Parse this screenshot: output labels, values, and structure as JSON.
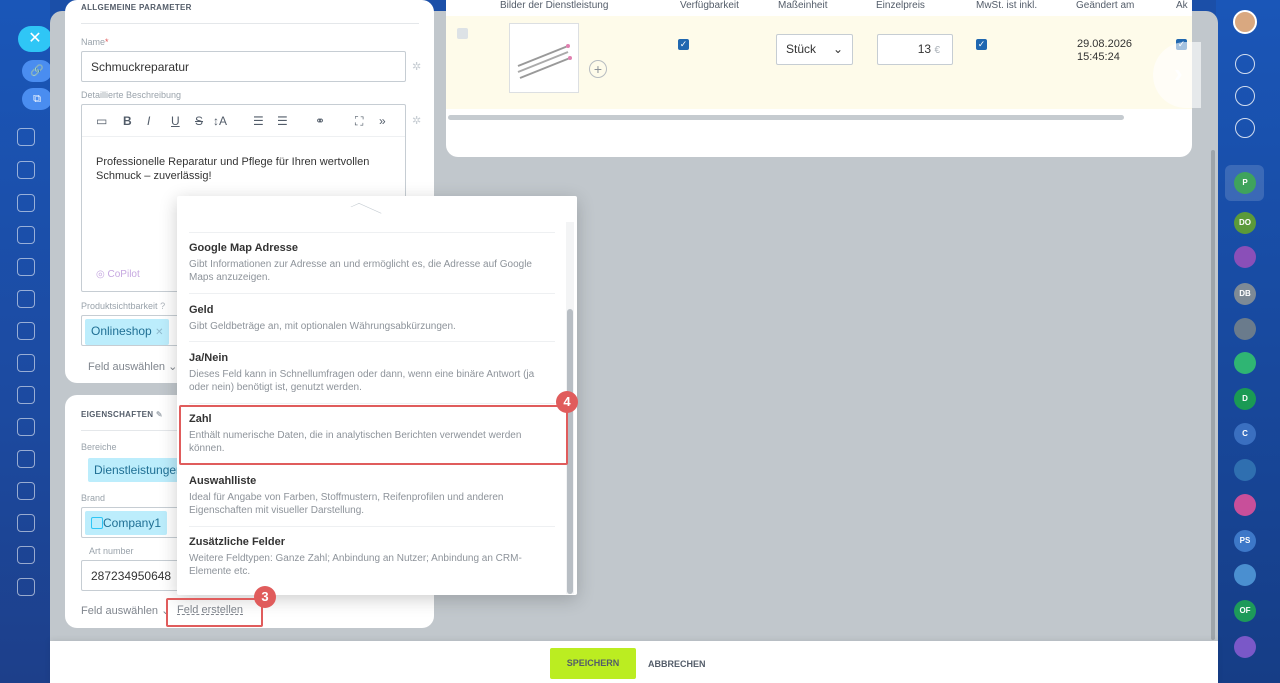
{
  "left_rail": {
    "close_icon": "✕"
  },
  "general": {
    "section_title": "ALLGEMEINE PARAMETER",
    "name_label": "Name",
    "name_required": "*",
    "name_value": "Schmuckreparatur",
    "desc_label": "Detaillierte Beschreibung",
    "desc_text": "Professionelle Reparatur und Pflege für Ihren wertvollen Schmuck – zuverlässig!",
    "copilot": "CoPilot",
    "visibility_label": "Produktsichtbarkeit",
    "visibility_tag": "Onlineshop",
    "select_field": "Feld auswählen"
  },
  "properties": {
    "section_title": "EIGENSCHAFTEN",
    "sections_label": "Bereiche",
    "sections_tag": "Dienstleistungen",
    "brand_label": "Brand",
    "brand_value": "Company1",
    "art_label": "Art number",
    "art_value": "287234950648",
    "select_field": "Feld auswählen",
    "create_field": "Feld erstellen"
  },
  "table": {
    "headers": [
      "Bilder der Dienstleistung",
      "Verfügbarkeit",
      "Maßeinheit",
      "Einzelpreis",
      "MwSt. ist inkl.",
      "Geändert am",
      "Ak"
    ],
    "unit": "Stück",
    "price": "13",
    "currency": "€",
    "changed": "29.08.2026\n15:45:24"
  },
  "popup": {
    "items": [
      {
        "title": "Google Map Adresse",
        "desc": "Gibt Informationen zur Adresse an und ermöglicht es, die Adresse auf Google Maps anzuzeigen."
      },
      {
        "title": "Geld",
        "desc": "Gibt Geldbeträge an, mit optionalen Währungsabkürzungen."
      },
      {
        "title": "Ja/Nein",
        "desc": "Dieses Feld kann in Schnellumfragen oder dann, wenn eine binäre Antwort (ja oder nein) benötigt ist, genutzt werden."
      },
      {
        "title": "Zahl",
        "desc": "Enthält numerische Daten, die in analytischen Berichten verwendet werden können."
      },
      {
        "title": "Auswahlliste",
        "desc": "Ideal für Angabe von Farben, Stoffmustern, Reifenprofilen und anderen Eigenschaften mit visueller Darstellung."
      },
      {
        "title": "Zusätzliche Felder",
        "desc": "Weitere Feldtypen: Ganze Zahl; Anbindung an Nutzer; Anbindung an CRM-Elemente etc."
      }
    ]
  },
  "steps": {
    "step3": "3",
    "step4": "4"
  },
  "footer": {
    "save": "SPEICHERN",
    "cancel": "ABBRECHEN"
  },
  "right_rail": {
    "avatars": [
      "P",
      "DO",
      "",
      "DB",
      "",
      "",
      "D",
      "C",
      "",
      "",
      "PS",
      "",
      "OF",
      ""
    ]
  }
}
